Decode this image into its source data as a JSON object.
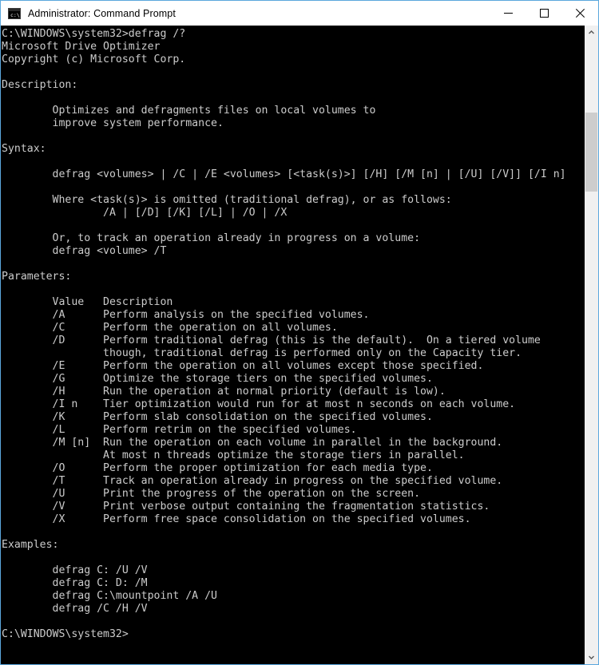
{
  "window": {
    "title": "Administrator: Command Prompt",
    "icon": "console-icon",
    "border_color": "#5ba7dd",
    "titlebar_background": "#ffffff",
    "console_background": "#000000",
    "console_foreground": "#cccccc",
    "controls": {
      "minimize": {
        "name": "minimize-button",
        "glyph": "minimize-icon",
        "label": "Minimize"
      },
      "maximize": {
        "name": "maximize-button",
        "glyph": "maximize-icon",
        "label": "Maximize"
      },
      "close": {
        "name": "close-button",
        "glyph": "close-icon",
        "label": "Close"
      }
    }
  },
  "scrollbar": {
    "up_arrow": "chevron-up-icon",
    "down_arrow": "chevron-down-icon",
    "thumb_top_pct": 12,
    "thumb_height_pct": 13,
    "track_color": "#f0f0f0",
    "thumb_color": "#cdcdcd"
  },
  "console": {
    "prompt_path": "C:\\WINDOWS\\system32>",
    "command": "defrag /?",
    "lines": [
      "C:\\WINDOWS\\system32>defrag /?",
      "Microsoft Drive Optimizer",
      "Copyright (c) Microsoft Corp.",
      "",
      "Description:",
      "",
      "        Optimizes and defragments files on local volumes to",
      "        improve system performance.",
      "",
      "Syntax:",
      "",
      "        defrag <volumes> | /C | /E <volumes> [<task(s)>] [/H] [/M [n] | [/U] [/V]] [/I n]",
      "",
      "        Where <task(s)> is omitted (traditional defrag), or as follows:",
      "                /A | [/D] [/K] [/L] | /O | /X",
      "",
      "        Or, to track an operation already in progress on a volume:",
      "        defrag <volume> /T",
      "",
      "Parameters:",
      "",
      "        Value   Description",
      "        /A      Perform analysis on the specified volumes.",
      "        /C      Perform the operation on all volumes.",
      "        /D      Perform traditional defrag (this is the default).  On a tiered volume",
      "                though, traditional defrag is performed only on the Capacity tier.",
      "        /E      Perform the operation on all volumes except those specified.",
      "        /G      Optimize the storage tiers on the specified volumes.",
      "        /H      Run the operation at normal priority (default is low).",
      "        /I n    Tier optimization would run for at most n seconds on each volume.",
      "        /K      Perform slab consolidation on the specified volumes.",
      "        /L      Perform retrim on the specified volumes.",
      "        /M [n]  Run the operation on each volume in parallel in the background.",
      "                At most n threads optimize the storage tiers in parallel.",
      "        /O      Perform the proper optimization for each media type.",
      "        /T      Track an operation already in progress on the specified volume.",
      "        /U      Print the progress of the operation on the screen.",
      "        /V      Print verbose output containing the fragmentation statistics.",
      "        /X      Perform free space consolidation on the specified volumes.",
      "",
      "Examples:",
      "",
      "        defrag C: /U /V",
      "        defrag C: D: /M",
      "        defrag C:\\mountpoint /A /U",
      "        defrag /C /H /V",
      "",
      "C:\\WINDOWS\\system32>"
    ]
  }
}
